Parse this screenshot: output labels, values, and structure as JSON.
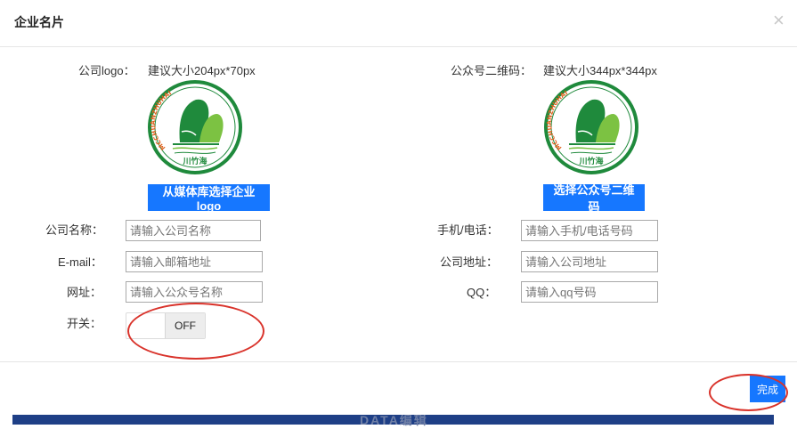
{
  "modal": {
    "title": "企业名片",
    "close_glyph": "×"
  },
  "backdrop": {
    "ghost_text": "DATA编辑"
  },
  "logo_section": {
    "label": "公司logo：",
    "hint": "建议大小204px*70px",
    "image_caption": "川竹海",
    "image_arc_text": "MCCHUANZHUHAI",
    "button_label": "从媒体库选择企业logo"
  },
  "qr_section": {
    "label": "公众号二维码：",
    "hint": "建议大小344px*344px",
    "image_caption": "川竹海",
    "image_arc_text": "MCCHUANZHUHAI",
    "button_label": "选择公众号二维码"
  },
  "form": {
    "company_name": {
      "label": "公司名称：",
      "placeholder": "请输入公司名称",
      "value": ""
    },
    "phone": {
      "label": "手机/电话：",
      "placeholder": "请输入手机/电话号码",
      "value": ""
    },
    "email": {
      "label": "E-mail：",
      "placeholder": "请输入邮箱地址",
      "value": ""
    },
    "address": {
      "label": "公司地址：",
      "placeholder": "请输入公司地址",
      "value": ""
    },
    "website": {
      "label": "网址：",
      "placeholder": "请输入公众号名称",
      "value": ""
    },
    "qq": {
      "label": "QQ：",
      "placeholder": "请输入qq号码",
      "value": ""
    },
    "switch": {
      "label": "开关：",
      "state_text": "OFF",
      "on": false
    }
  },
  "footer": {
    "done_label": "完成"
  },
  "colors": {
    "accent_blue": "#1677ff",
    "annotation_red": "#d9332b",
    "logo_green": "#1f8a3c",
    "logo_orange": "#e0611e"
  },
  "icons": {
    "close": "close-icon"
  }
}
